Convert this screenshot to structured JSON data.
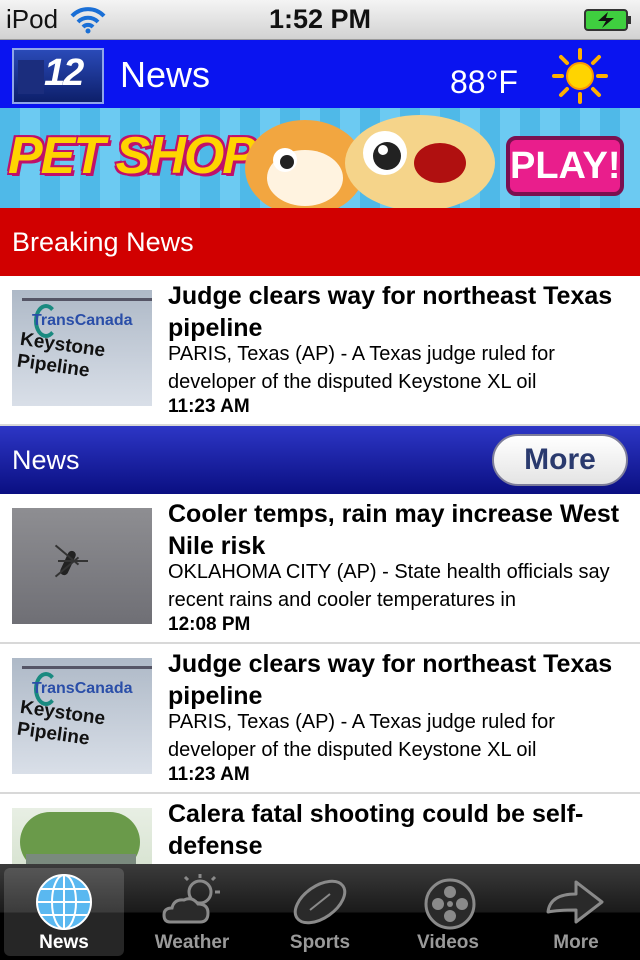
{
  "status_bar": {
    "carrier": "iPod",
    "time": "1:52 PM",
    "icons": [
      "wifi-icon",
      "battery-charging-icon"
    ]
  },
  "header": {
    "logo_text": "12",
    "title": "News",
    "temperature": "88°F",
    "weather_icon": "sun-icon",
    "colors": {
      "background": "#0a14f0",
      "text": "#ffffff"
    }
  },
  "banner_ad": {
    "text": "PET SHOP",
    "button": "PLAY!"
  },
  "breaking_section": {
    "label": "Breaking News",
    "color": "#d10000",
    "items": [
      {
        "title": "Judge clears way for northeast Texas pipeline",
        "summary": "PARIS, Texas (AP) - A Texas judge ruled for developer of the disputed Keystone XL oil",
        "time": "11:23 AM"
      }
    ]
  },
  "news_section": {
    "label": "News",
    "more_label": "More",
    "items": [
      {
        "title": "Cooler temps, rain may increase West Nile risk",
        "summary": "OKLAHOMA CITY (AP) - State health officials say recent rains and cooler temperatures in",
        "time": "12:08 PM"
      },
      {
        "title": "Judge clears way for northeast Texas pipeline",
        "summary": "PARIS, Texas (AP) - A Texas judge ruled for developer of the disputed Keystone XL oil",
        "time": "11:23 AM"
      },
      {
        "title": "Calera fatal shooting could be self-defense",
        "summary": "",
        "time": ""
      }
    ]
  },
  "thumbnail_text": {
    "transcanada": "TransCanada",
    "keystone": "Keystone Pipeline"
  },
  "tab_bar": {
    "tabs": [
      {
        "label": "News",
        "icon": "globe-icon",
        "active": true
      },
      {
        "label": "Weather",
        "icon": "weather-cloud-sun-icon",
        "active": false
      },
      {
        "label": "Sports",
        "icon": "football-icon",
        "active": false
      },
      {
        "label": "Videos",
        "icon": "film-reel-icon",
        "active": false
      },
      {
        "label": "More",
        "icon": "arrow-right-icon",
        "active": false
      }
    ]
  }
}
